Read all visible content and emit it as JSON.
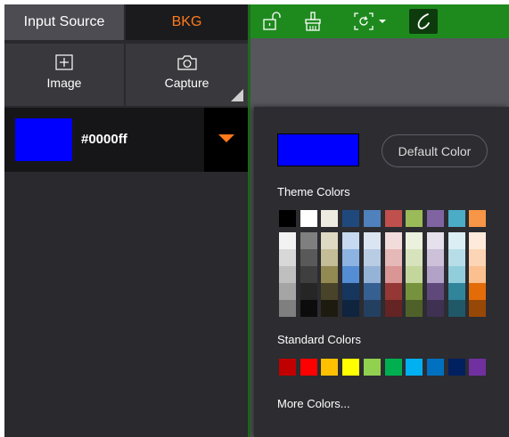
{
  "tabs": {
    "input_source": "Input Source",
    "bkg": "BKG"
  },
  "source_buttons": {
    "image": "Image",
    "capture": "Capture"
  },
  "current_color": {
    "hex": "#0000ff"
  },
  "picker": {
    "default_color_label": "Default Color",
    "theme_colors_label": "Theme Colors",
    "standard_colors_label": "Standard Colors",
    "more_colors_label": "More Colors...",
    "theme_top": [
      "#000000",
      "#ffffff",
      "#eeece1",
      "#1f497d",
      "#4f81bd",
      "#c0504d",
      "#9bbb59",
      "#8064a2",
      "#4bacc6",
      "#f79646"
    ],
    "theme_shades": [
      [
        "#f2f2f2",
        "#7f7f7f",
        "#ddd9c3",
        "#c6d9f0",
        "#dbe5f1",
        "#f2dcdb",
        "#ebf1dd",
        "#e5e0ec",
        "#dbeef3",
        "#fdeada"
      ],
      [
        "#d8d8d8",
        "#595959",
        "#c4bd97",
        "#8db3e2",
        "#b8cce4",
        "#e5b9b7",
        "#d7e3bc",
        "#ccc1d9",
        "#b7dde8",
        "#fbd5b5"
      ],
      [
        "#bfbfbf",
        "#3f3f3f",
        "#938953",
        "#548dd4",
        "#95b3d7",
        "#d99694",
        "#c3d69b",
        "#b2a2c7",
        "#92cddc",
        "#fac08f"
      ],
      [
        "#a5a5a5",
        "#262626",
        "#494429",
        "#17365d",
        "#366092",
        "#953734",
        "#76923c",
        "#5f497a",
        "#31859b",
        "#e36c09"
      ],
      [
        "#7f7f7f",
        "#0c0c0c",
        "#1d1b10",
        "#0f243e",
        "#244061",
        "#632423",
        "#4f6128",
        "#3f3151",
        "#205867",
        "#974806"
      ]
    ],
    "standard": [
      "#c00000",
      "#ff0000",
      "#ffc000",
      "#ffff00",
      "#92d050",
      "#00b050",
      "#00b0f0",
      "#0070c0",
      "#002060",
      "#7030a0"
    ]
  },
  "colors": {
    "accent_orange": "#ff7a1a",
    "toolbar_green": "#1e8a1e",
    "active_tool_bg": "#0d3b0d"
  },
  "toolbar_icons": [
    "unlock-icon",
    "brush-icon",
    "rotate-icon",
    "caret-down-icon",
    "curve-tool-icon"
  ]
}
